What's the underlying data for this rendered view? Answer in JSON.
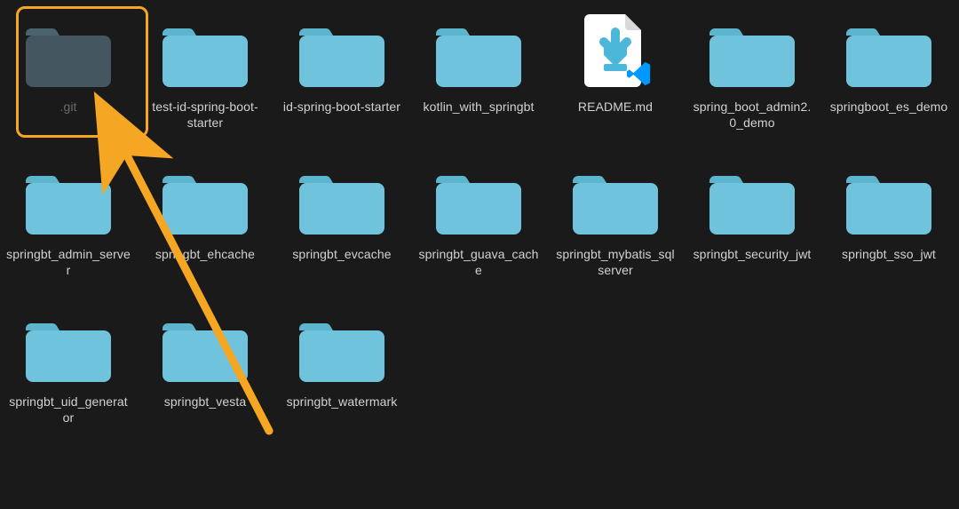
{
  "colors": {
    "background": "#1a1a1a",
    "text": "#d2d2d2",
    "textDim": "#6a6a6a",
    "folder": "#6fc3dc",
    "folderTab": "#5db4cd",
    "annotation": "#f5a623",
    "file": "#ffffff",
    "fileArrow": "#4cb7d8",
    "vscodeBlue": "#0098ff"
  },
  "items": [
    {
      "kind": "folder",
      "label": ".git",
      "selected": true,
      "dim": true
    },
    {
      "kind": "folder",
      "label": "test-id-spring-boot-starter"
    },
    {
      "kind": "folder",
      "label": "id-spring-boot-starter"
    },
    {
      "kind": "folder",
      "label": "kotlin_with_springbt"
    },
    {
      "kind": "file-md",
      "label": "README.md"
    },
    {
      "kind": "folder",
      "label": "spring_boot_admin2.0_demo"
    },
    {
      "kind": "folder",
      "label": "springboot_es_demo"
    },
    {
      "kind": "folder",
      "label": "springbt_admin_server"
    },
    {
      "kind": "folder",
      "label": "springbt_ehcache"
    },
    {
      "kind": "folder",
      "label": "springbt_evcache"
    },
    {
      "kind": "folder",
      "label": "springbt_guava_cache"
    },
    {
      "kind": "folder",
      "label": "springbt_mybatis_sqlserver"
    },
    {
      "kind": "folder",
      "label": "springbt_security_jwt"
    },
    {
      "kind": "folder",
      "label": "springbt_sso_jwt"
    },
    {
      "kind": "folder",
      "label": "springbt_uid_generator"
    },
    {
      "kind": "folder",
      "label": "springbt_vesta"
    },
    {
      "kind": "folder",
      "label": "springbt_watermark"
    }
  ]
}
